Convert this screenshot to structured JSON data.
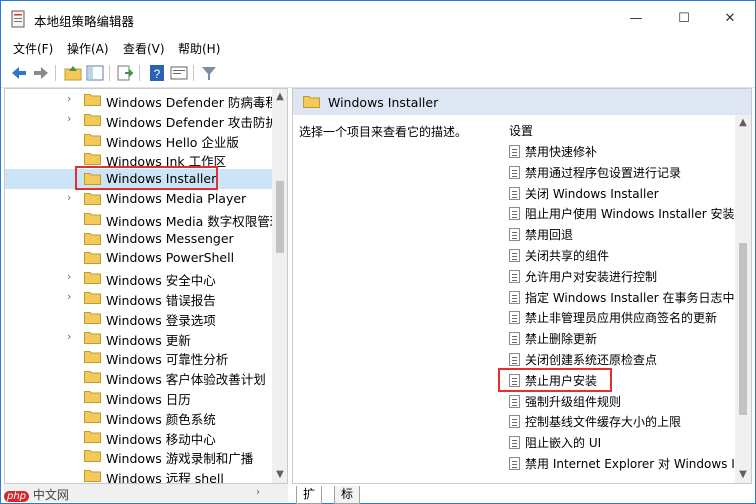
{
  "window": {
    "title": "本地组策略编辑器",
    "minimize": "—",
    "maximize": "☐",
    "close": "✕"
  },
  "menu": [
    "文件(F)",
    "操作(A)",
    "查看(V)",
    "帮助(H)"
  ],
  "toolbar_icons": [
    "back-arrow-icon",
    "forward-arrow-icon",
    "up-folder-icon",
    "show-hide-tree-icon",
    "export-list-icon",
    "help-icon",
    "properties-icon",
    "filter-icon"
  ],
  "tree": {
    "items": [
      {
        "label": "Windows Defender 防病毒程",
        "expandable": true
      },
      {
        "label": "Windows Defender 攻击防护",
        "expandable": true
      },
      {
        "label": "Windows Hello 企业版",
        "expandable": false
      },
      {
        "label": "Windows Ink 工作区",
        "expandable": false
      },
      {
        "label": "Windows Installer",
        "expandable": false,
        "selected": true
      },
      {
        "label": "Windows Media Player",
        "expandable": true
      },
      {
        "label": "Windows Media 数字权限管理",
        "expandable": false
      },
      {
        "label": "Windows Messenger",
        "expandable": false
      },
      {
        "label": "Windows PowerShell",
        "expandable": false
      },
      {
        "label": "Windows 安全中心",
        "expandable": true
      },
      {
        "label": "Windows 错误报告",
        "expandable": true
      },
      {
        "label": "Windows 登录选项",
        "expandable": false
      },
      {
        "label": "Windows 更新",
        "expandable": true
      },
      {
        "label": "Windows 可靠性分析",
        "expandable": false
      },
      {
        "label": "Windows 客户体验改善计划",
        "expandable": false
      },
      {
        "label": "Windows 日历",
        "expandable": false
      },
      {
        "label": "Windows 颜色系统",
        "expandable": false
      },
      {
        "label": "Windows 移动中心",
        "expandable": false
      },
      {
        "label": "Windows 游戏录制和广播",
        "expandable": false
      },
      {
        "label": "Windows 远程 shell",
        "expandable": false
      }
    ]
  },
  "right": {
    "header": "Windows Installer",
    "description": "选择一个项目来查看它的描述。",
    "settings_heading": "设置",
    "settings": [
      "禁用快速修补",
      "禁用通过程序包设置进行记录",
      "关闭 Windows Installer",
      "阻止用户使用 Windows Installer 安装",
      "禁用回退",
      "关闭共享的组件",
      "允许用户对安装进行控制",
      "指定 Windows Installer 在事务日志中",
      "禁止非管理员应用供应商签名的更新",
      "禁止删除更新",
      "关闭创建系统还原检查点",
      "禁止用户安装",
      "强制升级组件规则",
      "控制基线文件缓存大小的上限",
      "阻止嵌入的 UI",
      "禁用 Internet Explorer 对 Windows I"
    ]
  },
  "tabs": [
    "扩展",
    "标准"
  ],
  "watermark": {
    "logo": "php",
    "text": "中文网"
  },
  "colors": {
    "accent": "#2b7ad8",
    "highlight_box": "#e3302e",
    "selected_bg": "#cce4f7",
    "header_bg": "#dde6f2",
    "folder": "#f3c95c"
  }
}
